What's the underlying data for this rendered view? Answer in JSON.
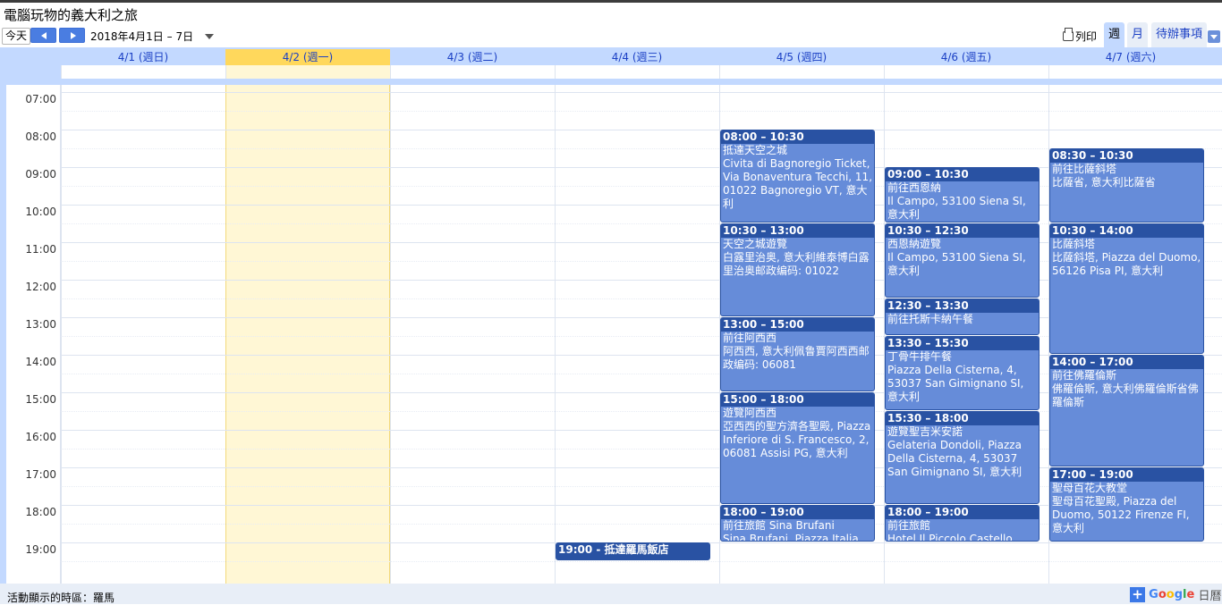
{
  "calendar_title": "電腦玩物的義大利之旅",
  "toolbar": {
    "today_label": "今天",
    "date_range": "2018年4月1日 – 7日",
    "print_label": "列印",
    "tab_week": "週",
    "tab_month": "月",
    "tab_agenda": "待辦事項"
  },
  "days": [
    {
      "label": "4/1 (週日)"
    },
    {
      "label": "4/2 (週一)"
    },
    {
      "label": "4/3 (週二)"
    },
    {
      "label": "4/4 (週三)"
    },
    {
      "label": "4/5 (週四)"
    },
    {
      "label": "4/6 (週五)"
    },
    {
      "label": "4/7 (週六)"
    }
  ],
  "hours": [
    "07:00",
    "08:00",
    "09:00",
    "10:00",
    "11:00",
    "12:00",
    "13:00",
    "14:00",
    "15:00",
    "16:00",
    "17:00",
    "18:00",
    "19:00"
  ],
  "events": [
    {
      "day": 4,
      "time": "08:00 – 10:30",
      "title": "抵達天空之城",
      "location": "Civita di Bagnoregio Ticket, Via Bonaventura Tecchi, 11, 01022 Bagnoregio VT, 意大利"
    },
    {
      "day": 4,
      "time": "10:30 – 13:00",
      "title": "天空之城遊覽",
      "location": "白露里治奥, 意大利維泰博白露里治奥邮政编码: 01022"
    },
    {
      "day": 4,
      "time": "13:00 – 15:00",
      "title": "前往阿西西",
      "location": "阿西西, 意大利佩鲁賈阿西西邮政编码: 06081"
    },
    {
      "day": 4,
      "time": "15:00 – 18:00",
      "title": "遊覽阿西西",
      "location": "亞西西的聖方濟各聖殿, Piazza Inferiore di S. Francesco, 2, 06081 Assisi PG, 意大利"
    },
    {
      "day": 4,
      "time": "18:00 – 19:00",
      "title": "前往旅館 Sina Brufani",
      "location": "Sina Brufani, Piazza Italia"
    },
    {
      "day": 5,
      "time": "09:00 – 10:30",
      "title": "前往西恩納",
      "location": "Il Campo, 53100 Siena SI, 意大利"
    },
    {
      "day": 5,
      "time": "10:30 – 12:30",
      "title": "西恩納遊覽",
      "location": "Il Campo, 53100 Siena SI, 意大利"
    },
    {
      "day": 5,
      "time": "12:30 – 13:30",
      "title": "前往托斯卡納午餐",
      "location": ""
    },
    {
      "day": 5,
      "time": "13:30 – 15:30",
      "title": "丁骨牛排午餐",
      "location": "Piazza Della Cisterna, 4, 53037 San Gimignano SI, 意大利"
    },
    {
      "day": 5,
      "time": "15:30 – 18:00",
      "title": "遊覽聖吉米安諾",
      "location": "Gelateria Dondoli, Piazza Della Cisterna, 4, 53037 San Gimignano SI, 意大利"
    },
    {
      "day": 5,
      "time": "18:00 – 19:00",
      "title": "前往旅館",
      "location": "Hotel Il Piccolo Castello"
    },
    {
      "day": 6,
      "time": "08:30 – 10:30",
      "title": "前往比薩斜塔",
      "location": "比薩省, 意大利比薩省"
    },
    {
      "day": 6,
      "time": "10:30 – 14:00",
      "title": "比薩斜塔",
      "location": "比薩斜塔, Piazza del Duomo, 56126 Pisa PI, 意大利"
    },
    {
      "day": 6,
      "time": "14:00 – 17:00",
      "title": "前往佛羅倫斯",
      "location": "佛羅倫斯, 意大利佛羅倫斯省佛羅倫斯"
    },
    {
      "day": 6,
      "time": "17:00 – 19:00",
      "title": "聖母百花大教堂",
      "location": "聖母百花聖殿, Piazza del Duomo, 50122 Firenze FI, 意大利"
    },
    {
      "day": 3,
      "time": "19:00 - 抵達羅馬飯店",
      "title": "",
      "location": ""
    }
  ],
  "footer": {
    "timezone_text": "活動顯示的時區：羅馬",
    "brand": "Google",
    "brand_suffix": "日曆"
  },
  "colors": {
    "event_fill": "#668cd9",
    "event_header": "#2952a3",
    "today_highlight": "#fff7d5",
    "frame": "#c3d9ff"
  }
}
